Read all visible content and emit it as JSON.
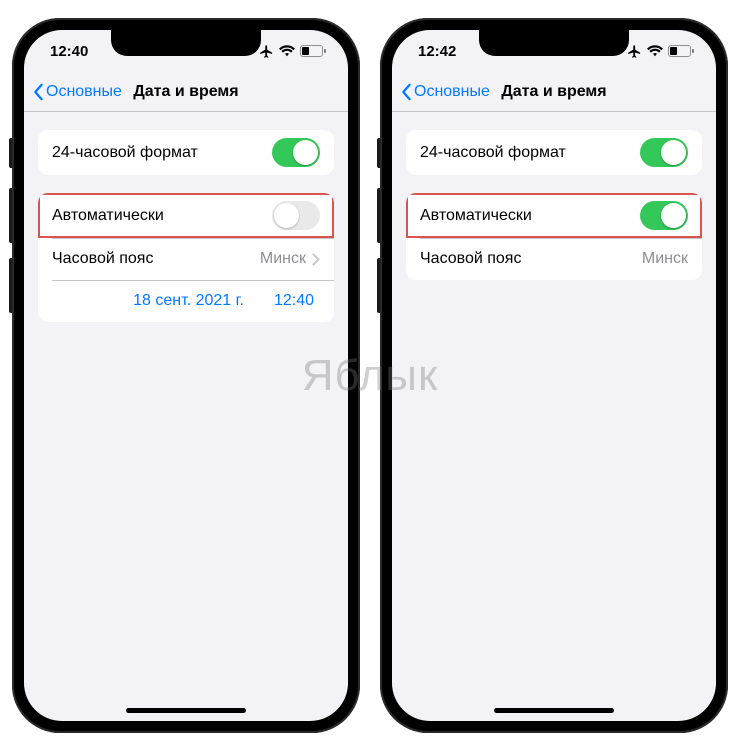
{
  "watermark": "Яблык",
  "left": {
    "time": "12:40",
    "back_label": "Основные",
    "title": "Дата и время",
    "row_24h": "24-часовой формат",
    "row_auto": "Автоматически",
    "row_tz_label": "Часовой пояс",
    "row_tz_value": "Минск",
    "date_value": "18 сент. 2021 г.",
    "time_value": "12:40",
    "toggle_24h": true,
    "toggle_auto": false
  },
  "right": {
    "time": "12:42",
    "back_label": "Основные",
    "title": "Дата и время",
    "row_24h": "24-часовой формат",
    "row_auto": "Автоматически",
    "row_tz_label": "Часовой пояс",
    "row_tz_value": "Минск",
    "toggle_24h": true,
    "toggle_auto": true
  }
}
